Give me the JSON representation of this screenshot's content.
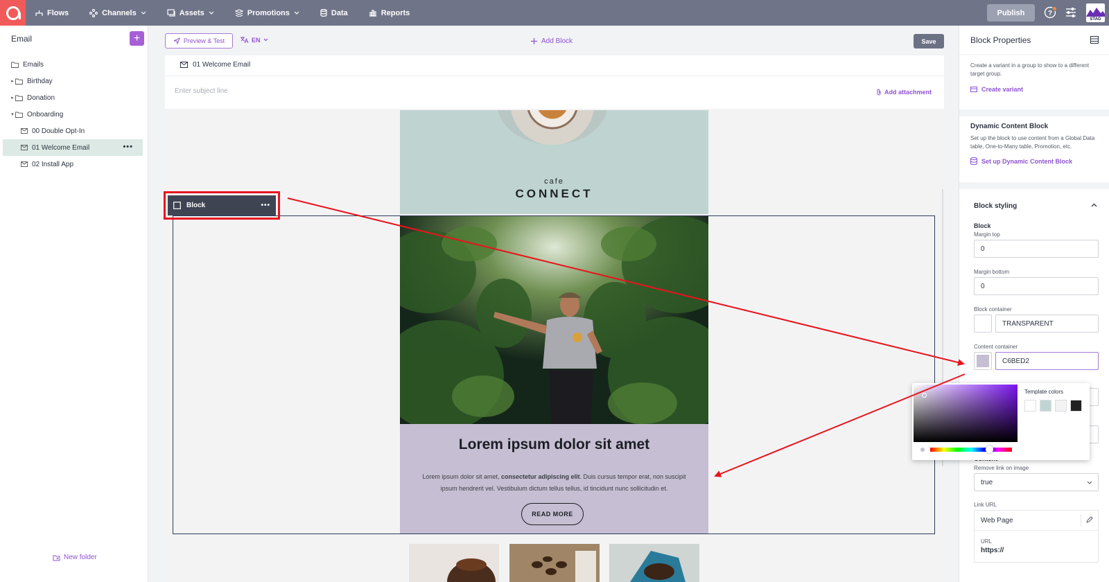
{
  "nav": {
    "items": [
      {
        "label": "Flows",
        "icon": "flows-icon",
        "chevron": false
      },
      {
        "label": "Channels",
        "icon": "channels-icon",
        "chevron": true
      },
      {
        "label": "Assets",
        "icon": "assets-icon",
        "chevron": true
      },
      {
        "label": "Promotions",
        "icon": "promotions-icon",
        "chevron": true
      },
      {
        "label": "Data",
        "icon": "data-icon",
        "chevron": false
      },
      {
        "label": "Reports",
        "icon": "reports-icon",
        "chevron": false
      }
    ],
    "publish_label": "Publish",
    "env_badge": "STAG"
  },
  "sidebar": {
    "title": "Email",
    "tree": [
      {
        "label": "Emails",
        "type": "folder",
        "level": 0,
        "caret": ""
      },
      {
        "label": "Birthday",
        "type": "folder",
        "level": 1,
        "caret": "▸"
      },
      {
        "label": "Donation",
        "type": "folder",
        "level": 1,
        "caret": "▸"
      },
      {
        "label": "Onboarding",
        "type": "folder",
        "level": 1,
        "caret": "▾"
      },
      {
        "label": "00 Double Opt-In",
        "type": "email",
        "level": 2,
        "caret": ""
      },
      {
        "label": "01 Welcome Email",
        "type": "email",
        "level": 2,
        "caret": "",
        "selected": true
      },
      {
        "label": "02 Install App",
        "type": "email",
        "level": 2,
        "caret": ""
      }
    ],
    "new_folder_label": "New folder"
  },
  "editor": {
    "preview_label": "Preview & Test",
    "language": "EN",
    "add_block_label": "Add Block",
    "save_label": "Save",
    "email_name": "01 Welcome Email",
    "subject_placeholder": "Enter subject line",
    "add_attachment_label": "Add attachment",
    "block_chip_label": "Block"
  },
  "email": {
    "brand_small": "cafe",
    "brand_big": "CONNECT",
    "headline": "Lorem ipsum dolor sit amet",
    "body_before": "Lorem ipsum dolor sit amet, ",
    "body_bold": "consectetur adipiscing elit",
    "body_after": ". Duis cursus tempor erat, non suscipit ipsum hendrerit vel. Vestibulum dictum tellus tellus, id tincidunt nunc sollicitudin et.",
    "cta_label": "READ MORE"
  },
  "panel": {
    "title": "Block Properties",
    "variant_text": "Create a variant in a group to show to a different target group.",
    "create_variant_label": "Create variant",
    "dynamic_title": "Dynamic Content Block",
    "dynamic_text": "Set up the block to use content from a Global Data table, One-to-Many table, Promotion, etc.",
    "dynamic_link": "Set up Dynamic Content Block",
    "styling_title": "Block styling",
    "block_heading": "Block",
    "margin_top_label": "Margin top",
    "margin_top_value": "0",
    "margin_bottom_label": "Margin bottom",
    "margin_bottom_value": "0",
    "block_container_label": "Block container",
    "block_container_value": "TRANSPARENT",
    "content_container_label": "Content container",
    "content_container_value": "C6BED2",
    "content_container_color": "#C6BED2",
    "content_heading": "Content",
    "remove_link_label": "Remove link on image",
    "remove_link_value": "true",
    "link_url_label": "Link URL",
    "link_type_value": "Web Page",
    "url_label": "URL",
    "url_value": "https://"
  },
  "picker": {
    "template_colors_label": "Template colors",
    "template_colors": [
      "#ffffff",
      "#c0d5d3",
      "#f3f3f4",
      "#222222"
    ]
  },
  "colors": {
    "accent": "#8d53d1",
    "nav_bg": "#6f7488",
    "logo": "#f05a5a",
    "annotation": "#e8141d"
  }
}
